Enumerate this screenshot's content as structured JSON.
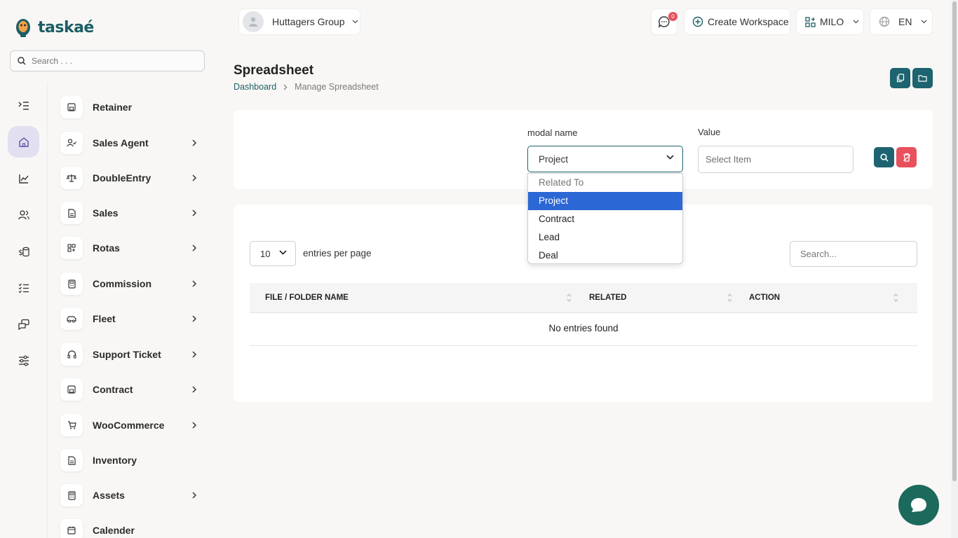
{
  "brand": {
    "name": "taskaé"
  },
  "sidebar": {
    "search_placeholder": "Search . . .",
    "items": [
      {
        "label": "Retainer",
        "icon": "save-icon",
        "has_children": false
      },
      {
        "label": "Sales Agent",
        "icon": "user-check-icon",
        "has_children": true
      },
      {
        "label": "DoubleEntry",
        "icon": "scale-icon",
        "has_children": true
      },
      {
        "label": "Sales",
        "icon": "file-icon",
        "has_children": true
      },
      {
        "label": "Rotas",
        "icon": "grid-icon",
        "has_children": true
      },
      {
        "label": "Commission",
        "icon": "calculator-icon",
        "has_children": true
      },
      {
        "label": "Fleet",
        "icon": "car-icon",
        "has_children": true
      },
      {
        "label": "Support Ticket",
        "icon": "headset-icon",
        "has_children": true
      },
      {
        "label": "Contract",
        "icon": "save-icon",
        "has_children": true
      },
      {
        "label": "WooCommerce",
        "icon": "cart-icon",
        "has_children": true
      },
      {
        "label": "Inventory",
        "icon": "file-icon",
        "has_children": false
      },
      {
        "label": "Assets",
        "icon": "calculator-icon",
        "has_children": true
      },
      {
        "label": "Calender",
        "icon": "calendar-icon",
        "has_children": false
      }
    ]
  },
  "topbar": {
    "workspace": "Huttagers Group",
    "messages_count": "0",
    "create_workspace": "Create Workspace",
    "user": "MILO",
    "language": "EN"
  },
  "page": {
    "title": "Spreadsheet",
    "breadcrumb": [
      "Dashboard",
      "Manage Spreadsheet"
    ]
  },
  "filters": {
    "modal_label": "modal name",
    "modal_value": "Project",
    "value_label": "Value",
    "value_placeholder": "Select Item",
    "options": [
      "Related To",
      "Project",
      "Contract",
      "Lead",
      "Deal"
    ],
    "selected_option": "Project"
  },
  "table": {
    "page_size": "10",
    "entries_label": "entries per page",
    "search_placeholder": "Search...",
    "columns": [
      "FILE / FOLDER NAME",
      "RELATED",
      "ACTION"
    ],
    "empty_message": "No entries found"
  },
  "colors": {
    "primary": "#1d6470",
    "danger": "#e8505b",
    "selected_option": "#2c67d6",
    "chat_fab": "#1b6a5c"
  }
}
